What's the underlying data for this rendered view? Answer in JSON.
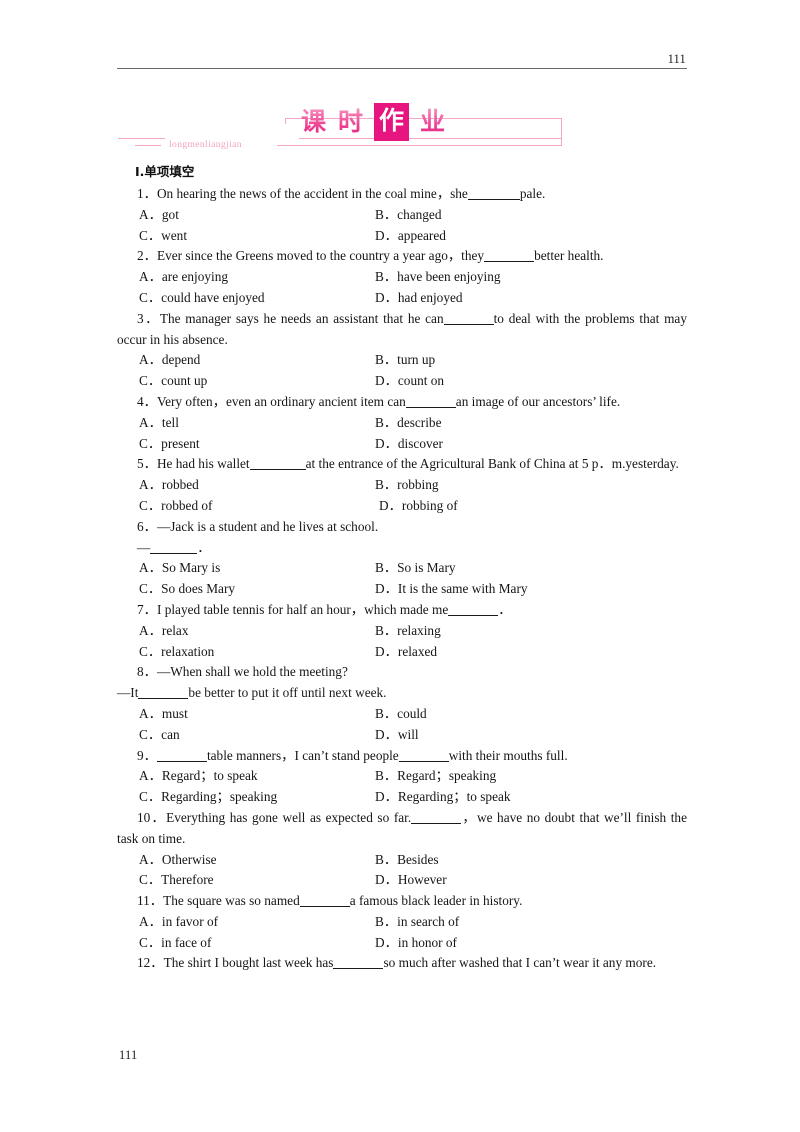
{
  "header": {
    "page_number": "111"
  },
  "banner": {
    "title_chars": [
      "课",
      "时",
      "作",
      "业"
    ],
    "boxed_char_index": 2,
    "subtitle": "longmenliangjian",
    "accent_color": "#e6157f",
    "line_color": "#f3a8c6"
  },
  "section": {
    "heading": "Ⅰ.单项填空"
  },
  "questions": [
    {
      "number": "1",
      "stem_before": "1．On hearing the news of the accident in the coal mine，she",
      "stem_after": "pale.",
      "options": [
        {
          "key": "A",
          "text": "A．got"
        },
        {
          "key": "B",
          "text": "B．changed"
        },
        {
          "key": "C",
          "text": "C．went"
        },
        {
          "key": "D",
          "text": "D．appeared"
        }
      ]
    },
    {
      "number": "2",
      "stem_before": "2．Ever since the Greens moved to the country a year ago，they",
      "stem_after": "better health.",
      "options": [
        {
          "key": "A",
          "text": "A．are enjoying"
        },
        {
          "key": "B",
          "text": "B．have been enjoying"
        },
        {
          "key": "C",
          "text": "C．could have enjoyed"
        },
        {
          "key": "D",
          "text": "D．had enjoyed"
        }
      ]
    },
    {
      "number": "3",
      "stem_before": "3．The manager says he needs an assistant that he can",
      "stem_after": "to deal with the problems that may occur in his absence.",
      "options": [
        {
          "key": "A",
          "text": "A．depend"
        },
        {
          "key": "B",
          "text": "B．turn up"
        },
        {
          "key": "C",
          "text": "C．count up"
        },
        {
          "key": "D",
          "text": "D．count on"
        }
      ]
    },
    {
      "number": "4",
      "stem_before": "4．Very often，even an ordinary ancient item can",
      "stem_after": "an image of our ancestors’ life.",
      "options": [
        {
          "key": "A",
          "text": "A．tell"
        },
        {
          "key": "B",
          "text": "B．describe"
        },
        {
          "key": "C",
          "text": "C．present"
        },
        {
          "key": "D",
          "text": "D．discover"
        }
      ]
    },
    {
      "number": "5",
      "stem_before": "5．He had his wallet",
      "stem_after": "at the entrance of the Agricultural Bank of China at 5 p．m.yesterday.",
      "options": [
        {
          "key": "A",
          "text": "A．robbed"
        },
        {
          "key": "B",
          "text": "B．robbing"
        },
        {
          "key": "C",
          "text": "C．robbed of"
        },
        {
          "key": "D",
          "text": "D．robbing of"
        }
      ]
    },
    {
      "number": "6",
      "stem_before": "6．—Jack is a student and he lives at school.",
      "stem_after": "—",
      "stem_after_tail": "．",
      "options": [
        {
          "key": "A",
          "text": "A．So Mary is"
        },
        {
          "key": "B",
          "text": "B．So is Mary"
        },
        {
          "key": "C",
          "text": "C．So does Mary"
        },
        {
          "key": "D",
          "text": "D．It is the same with Mary"
        }
      ]
    },
    {
      "number": "7",
      "stem_before": "7．I played table tennis for half an hour，which made me",
      "stem_after": "．",
      "options": [
        {
          "key": "A",
          "text": "A．relax"
        },
        {
          "key": "B",
          "text": "B．relaxing"
        },
        {
          "key": "C",
          "text": "C．relaxation"
        },
        {
          "key": "D",
          "text": "D．relaxed"
        }
      ]
    },
    {
      "number": "8",
      "stem_before": "8．—When shall we hold the meeting?",
      "stem_line2_before": "—It",
      "stem_line2_after": "be better to put it off until next week.",
      "options": [
        {
          "key": "A",
          "text": "A．must"
        },
        {
          "key": "B",
          "text": "B．could"
        },
        {
          "key": "C",
          "text": "C．can"
        },
        {
          "key": "D",
          "text": "D．will"
        }
      ]
    },
    {
      "number": "9",
      "stem_before": "9．",
      "stem_mid": "table manners，I can’t stand people",
      "stem_after": "with their mouths full.",
      "options": [
        {
          "key": "A",
          "text": "A．Regard；to speak"
        },
        {
          "key": "B",
          "text": "B．Regard；speaking"
        },
        {
          "key": "C",
          "text": "C．Regarding；speaking"
        },
        {
          "key": "D",
          "text": "D．Regarding；to speak"
        }
      ]
    },
    {
      "number": "10",
      "stem_before": "10．Everything has gone well as expected so far.",
      "stem_after": "，we have no doubt that we’ll finish the task on time.",
      "options": [
        {
          "key": "A",
          "text": "A．Otherwise"
        },
        {
          "key": "B",
          "text": "B．Besides"
        },
        {
          "key": "C",
          "text": "C．Therefore"
        },
        {
          "key": "D",
          "text": "D．However"
        }
      ]
    },
    {
      "number": "11",
      "stem_before": "11．The square was so named",
      "stem_after": "a famous black leader in history.",
      "options": [
        {
          "key": "A",
          "text": "A．in favor of"
        },
        {
          "key": "B",
          "text": "B．in search of"
        },
        {
          "key": "C",
          "text": "C．in face of"
        },
        {
          "key": "D",
          "text": "D．in honor of"
        }
      ]
    },
    {
      "number": "12",
      "stem_before": "12．The shirt I bought last week has",
      "stem_after": "so much after washed that I can’t wear it any more.",
      "options": []
    }
  ],
  "footer": {
    "page_number": "111"
  }
}
